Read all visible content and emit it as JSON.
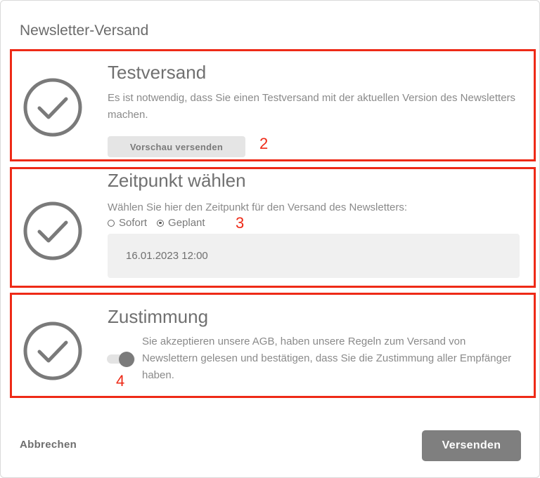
{
  "dialog": {
    "title": "Newsletter-Versand"
  },
  "sections": [
    {
      "heading": "Testversand",
      "text": "Es ist notwendig, dass Sie einen Testversand mit der aktuellen Version des Newsletters machen.",
      "button_label": "Vorschau versenden",
      "annotation": "2",
      "icon": "check-circle-icon"
    },
    {
      "heading": "Zeitpunkt wählen",
      "text": "Wählen Sie hier den Zeitpunkt für den Versand des Newsletters:",
      "radio_options": [
        {
          "label": "Sofort",
          "checked": false
        },
        {
          "label": "Geplant",
          "checked": true
        }
      ],
      "date_value": "16.01.2023 12:00",
      "annotation": "3",
      "icon": "check-circle-icon"
    },
    {
      "heading": "Zustimmung",
      "text": "Sie akzeptieren unsere AGB, haben unsere Regeln zum Versand von Newslettern gelesen und bestätigen, dass Sie die Zustimmung aller Empfänger haben.",
      "toggle_on": true,
      "annotation": "4",
      "icon": "check-circle-icon"
    }
  ],
  "footer": {
    "cancel_label": "Abbrechen",
    "send_label": "Versenden"
  },
  "colors": {
    "highlight_border": "#ee2a17",
    "primary_button": "#7f7f7f",
    "text_gray": "#8a8a8a"
  }
}
